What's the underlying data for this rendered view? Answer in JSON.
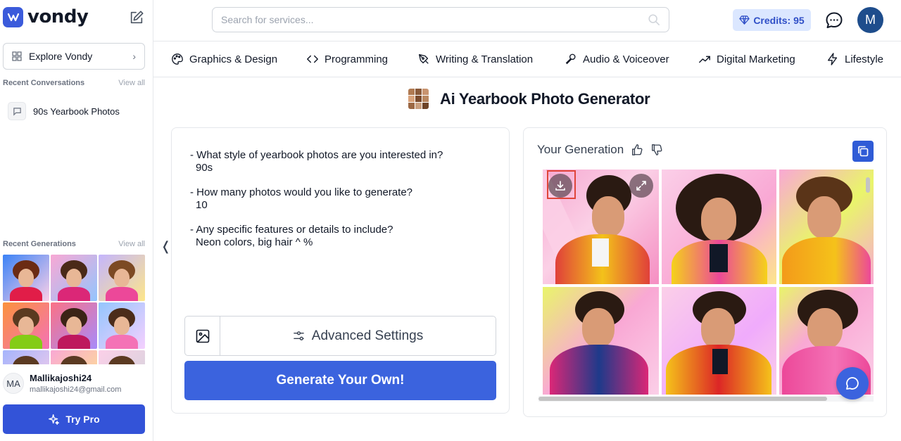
{
  "brand": {
    "name": "vondy",
    "accent": "#3b63de"
  },
  "sidebar": {
    "explore_label": "Explore Vondy",
    "recent_conversations": {
      "title": "Recent Conversations",
      "view_all": "View all",
      "items": [
        {
          "label": "90s Yearbook Photos"
        }
      ]
    },
    "recent_generations": {
      "title": "Recent Generations",
      "view_all": "View all"
    },
    "user": {
      "initials": "MA",
      "name": "Mallikajoshi24",
      "email": "mallikajoshi24@gmail.com"
    },
    "try_pro_label": "Try Pro"
  },
  "header": {
    "search_placeholder": "Search for services...",
    "credits_label": "Credits: 95",
    "avatar_initial": "M"
  },
  "categories": [
    {
      "label": "Graphics & Design",
      "icon": "palette-icon"
    },
    {
      "label": "Programming",
      "icon": "code-icon"
    },
    {
      "label": "Writing & Translation",
      "icon": "pen-icon"
    },
    {
      "label": "Audio & Voiceover",
      "icon": "microphone-icon"
    },
    {
      "label": "Digital Marketing",
      "icon": "trend-up-icon"
    },
    {
      "label": "Lifestyle",
      "icon": "lightning-icon"
    }
  ],
  "tool": {
    "title": "Ai Yearbook Photo Generator"
  },
  "prompt": {
    "items": [
      {
        "q": "- What style of yearbook photos are you interested in?",
        "a": "90s"
      },
      {
        "q": "- How many photos would you like to generate?",
        "a": "10"
      },
      {
        "q": "- Any specific features or details to include?",
        "a": "Neon colors, big hair ^ %"
      }
    ],
    "advanced_label": "Advanced Settings",
    "generate_label": "Generate Your Own!"
  },
  "generation": {
    "title": "Your Generation"
  }
}
